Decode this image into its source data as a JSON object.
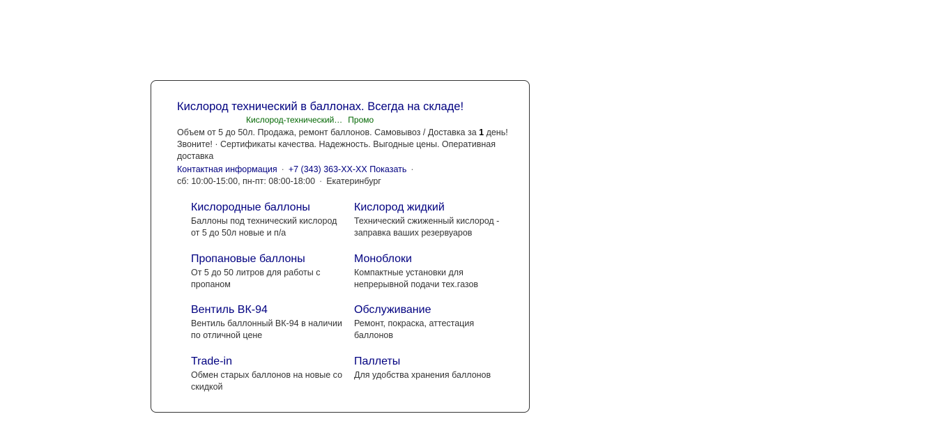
{
  "ad": {
    "title": "Кислород технический в баллонах. Всегда на складе!",
    "url_display": "Кислород-технический…",
    "promo_label": "Промо",
    "text_before_bold": "Объем от 5 до 50л. Продажа, ремонт баллонов. Самовывоз / Доставка за ",
    "text_bold": "1",
    "text_after_bold": " день! Звоните! · Сертификаты качества. Надежность. Выгодные цены. Оперативная доставка",
    "contact": {
      "contact_info_label": "Контактная информация",
      "phone": "+7 (343) 363-XX-XX",
      "show_label": "Показать"
    },
    "hours": "сб: 10:00-15:00, пн-пт: 08:00-18:00",
    "city": "Екатеринбург",
    "separator": "·"
  },
  "sitelinks": [
    {
      "title": "Кислородные баллоны",
      "desc": "Баллоны под технический кислород от 5 до 50л новые и п/а"
    },
    {
      "title": "Кислород жидкий",
      "desc": "Технический сжиженный кислород - заправка ваших резервуаров"
    },
    {
      "title": "Пропановые баллоны",
      "desc": "От 5 до 50 литров для работы с пропаном"
    },
    {
      "title": "Моноблоки",
      "desc": "Компактные установки для непрерывной подачи тех.газов"
    },
    {
      "title": "Вентиль ВК-94",
      "desc": "Вентиль баллонный ВК-94 в наличии по отличной цене"
    },
    {
      "title": "Обслуживание",
      "desc": "Ремонт, покраска, аттестация баллонов"
    },
    {
      "title": "Trade-in",
      "desc": "Обмен старых баллонов на новые со скидкой"
    },
    {
      "title": "Паллеты",
      "desc": "Для удобства хранения баллонов"
    }
  ],
  "colors": {
    "link": "#000080",
    "url_green": "#006600",
    "text": "#333333",
    "border": "#333333"
  }
}
